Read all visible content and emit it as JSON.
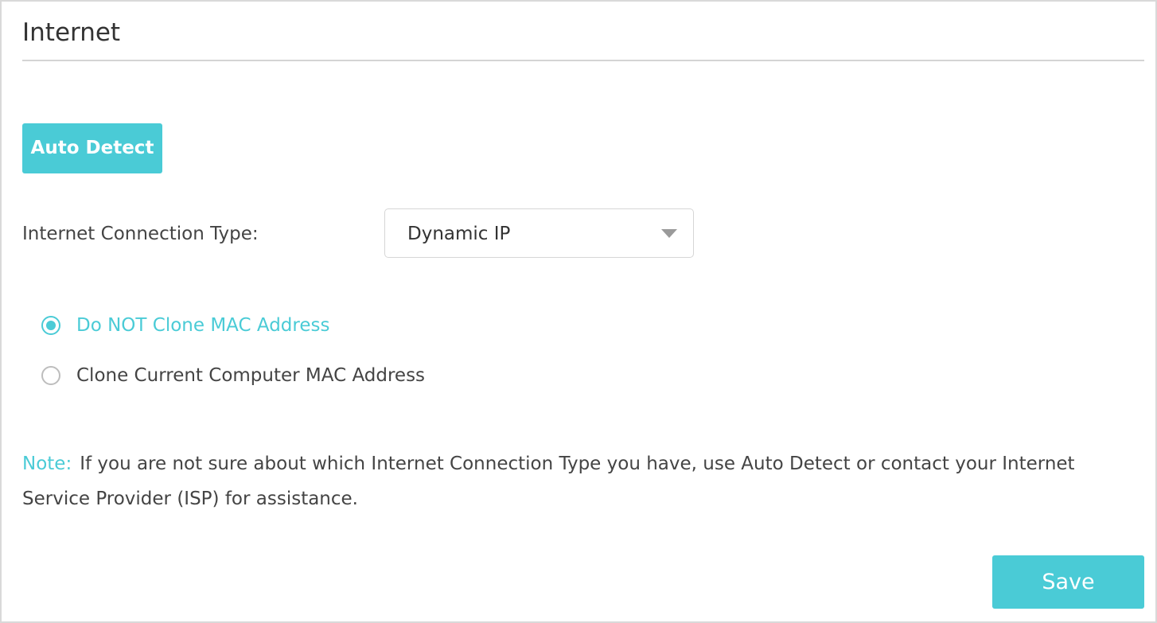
{
  "header": {
    "title": "Internet"
  },
  "auto_detect": {
    "label": "Auto Detect"
  },
  "connection_type": {
    "label": "Internet Connection Type:",
    "selected": "Dynamic IP"
  },
  "mac_clone": {
    "options": [
      {
        "label": "Do NOT Clone MAC Address",
        "checked": true
      },
      {
        "label": "Clone Current Computer MAC Address",
        "checked": false
      }
    ]
  },
  "note": {
    "label": "Note:",
    "text": "If you are not sure about which Internet Connection Type you have, use Auto Detect or contact your Internet Service Provider (ISP) for assistance."
  },
  "footer": {
    "save_label": "Save"
  },
  "colors": {
    "accent": "#4acbd6",
    "text": "#444444",
    "divider": "#d4d4d4"
  }
}
